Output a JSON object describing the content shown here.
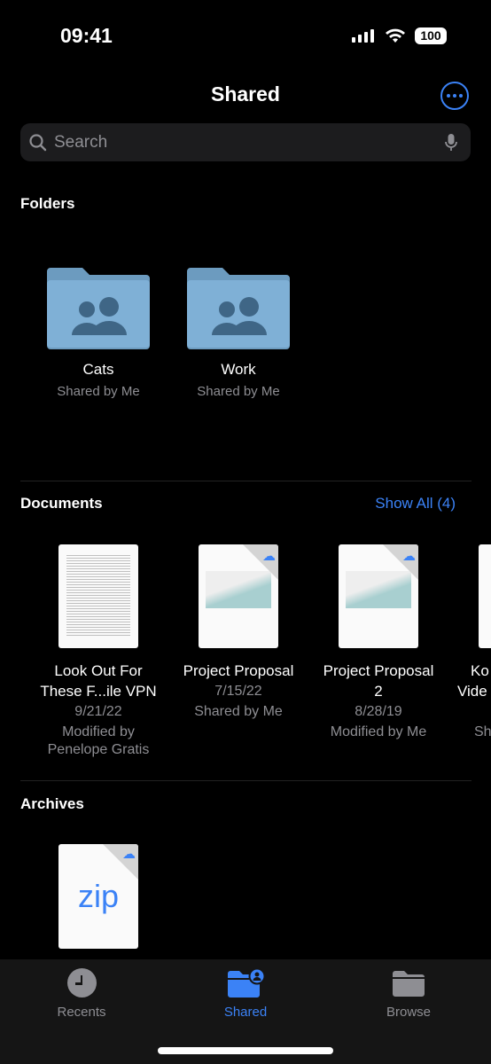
{
  "status": {
    "time": "09:41",
    "battery": "100"
  },
  "header": {
    "title": "Shared",
    "more_icon": "ellipsis-circle-icon"
  },
  "search": {
    "placeholder": "Search"
  },
  "folders": {
    "label": "Folders",
    "items": [
      {
        "name": "Cats",
        "sub": "Shared by Me"
      },
      {
        "name": "Work",
        "sub": "Shared by Me"
      }
    ]
  },
  "documents": {
    "label": "Documents",
    "show_all": "Show All (4)",
    "items": [
      {
        "line1": "Look Out For",
        "line2": "These F...ile VPN",
        "date": "9/21/22",
        "info1": "Modified by",
        "info2": "Penelope Gratis"
      },
      {
        "line1": "Project Proposal",
        "line2": "",
        "date": "7/15/22",
        "info1": "Shared by Me",
        "info2": ""
      },
      {
        "line1": "Project Proposal",
        "line2": "2",
        "date": "8/28/19",
        "info1": "Modified by Me",
        "info2": ""
      },
      {
        "line1": "Ko",
        "line2": "Vide",
        "date": "",
        "info1": "Sh",
        "info2": ""
      }
    ],
    "thumb_caption": "Project Proposal"
  },
  "archives": {
    "label": "Archives",
    "items": [
      {
        "ext": "zip"
      }
    ]
  },
  "tabs": [
    {
      "label": "Recents"
    },
    {
      "label": "Shared",
      "active": true
    },
    {
      "label": "Browse"
    }
  ],
  "colors": {
    "accent": "#3b82f6",
    "folder": "#7fb0d6"
  }
}
